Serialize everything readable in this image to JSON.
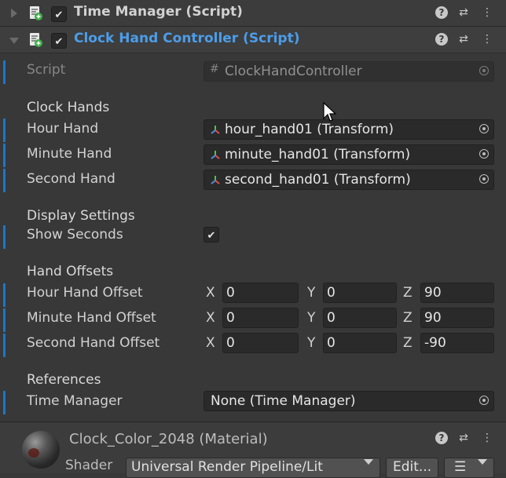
{
  "components": [
    {
      "title": "Time Manager (Script)",
      "expanded": false,
      "enabled": true
    },
    {
      "title": "Clock Hand Controller (Script)",
      "expanded": true,
      "enabled": true,
      "title_color": "#4c9dea"
    }
  ],
  "script_field": {
    "label": "Script",
    "value": "ClockHandController"
  },
  "sections": {
    "clock_hands": "Clock Hands",
    "display_settings": "Display Settings",
    "hand_offsets": "Hand Offsets",
    "references": "References"
  },
  "hands": [
    {
      "label": "Hour Hand",
      "value": "hour_hand01 (Transform)"
    },
    {
      "label": "Minute Hand",
      "value": "minute_hand01 (Transform)"
    },
    {
      "label": "Second Hand",
      "value": "second_hand01 (Transform)"
    }
  ],
  "show_seconds": {
    "label": "Show Seconds",
    "checked": true,
    "check_glyph": "✔"
  },
  "offsets": [
    {
      "label": "Hour Hand Offset",
      "x": "0",
      "y": "0",
      "z": "90"
    },
    {
      "label": "Minute Hand Offset",
      "x": "0",
      "y": "0",
      "z": "90"
    },
    {
      "label": "Second Hand Offset",
      "x": "0",
      "y": "0",
      "z": "-90"
    }
  ],
  "axis_labels": {
    "x": "X",
    "y": "Y",
    "z": "Z"
  },
  "time_manager": {
    "label": "Time Manager",
    "value": "None (Time Manager)"
  },
  "material": {
    "title": "Clock_Color_2048 (Material)",
    "shader_label": "Shader",
    "shader_value": "Universal Render Pipeline/Lit",
    "edit_label": "Edit..."
  },
  "icons": {
    "help": "?",
    "settings": "⇄",
    "more": "⋮",
    "list": "☰"
  },
  "colors": {
    "accent_bar": "#1b76c9",
    "background": "#383838"
  }
}
